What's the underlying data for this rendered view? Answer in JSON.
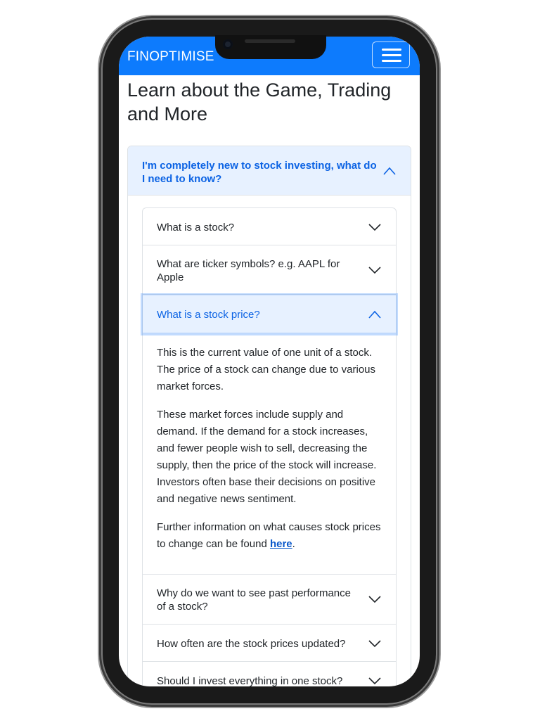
{
  "navbar": {
    "brand": "FINOPTIMISE",
    "menu_icon": "hamburger-menu-icon"
  },
  "page": {
    "title": "Learn about the Game, Trading and More"
  },
  "accordion": {
    "outer_question": "I'm completely new to stock investing, what do I need to know?",
    "items": [
      {
        "label": "What is a stock?"
      },
      {
        "label": "What are ticker symbols? e.g. AAPL for Apple"
      },
      {
        "label": "What is a stock price?"
      },
      {
        "label": "Why do we want to see past performance of a stock?"
      },
      {
        "label": "How often are the stock prices updated?"
      },
      {
        "label": "Should I invest everything in one stock?"
      }
    ],
    "open_answer": {
      "p1": "This is the current value of one unit of a stock. The price of a stock can change due to various market forces.",
      "p2": "These market forces include supply and demand. If the demand for a stock increases, and fewer people wish to sell, decreasing the supply, then the price of the stock will increase. Investors often base their decisions on positive and negative news sentiment.",
      "p3_prefix": "Further information on what causes stock prices to change can be found ",
      "p3_link": "here",
      "p3_suffix": "."
    }
  },
  "colors": {
    "navbar": "#0d7bfd",
    "active_bg": "#e7f1ff",
    "active_text": "#0c63e4"
  }
}
